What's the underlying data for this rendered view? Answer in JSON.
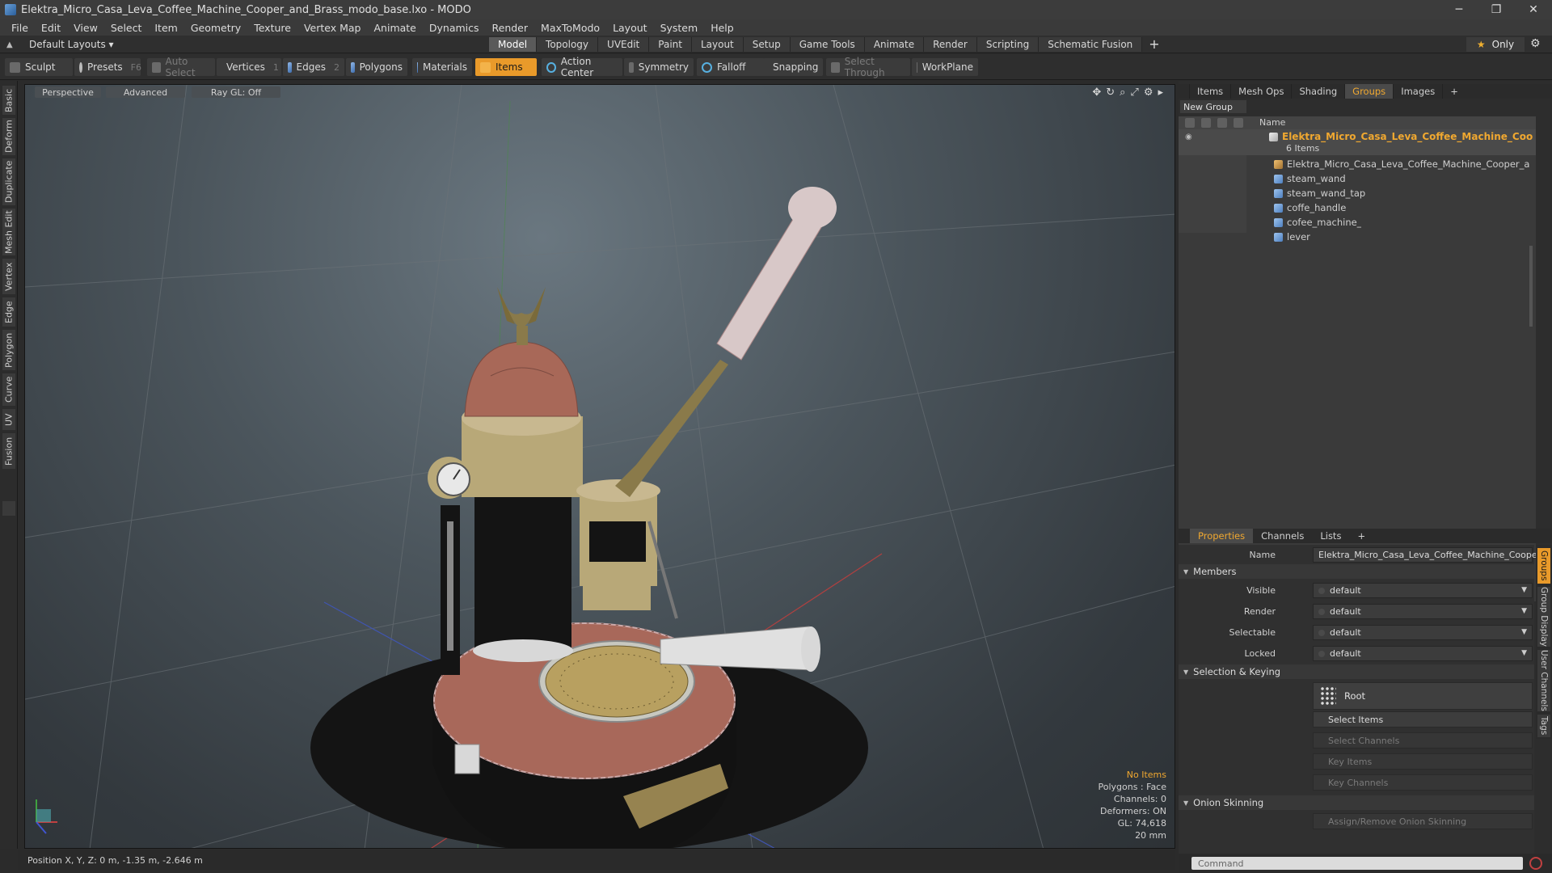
{
  "window": {
    "title": "Elektra_Micro_Casa_Leva_Coffee_Machine_Cooper_and_Brass_modo_base.lxo - MODO",
    "min": "─",
    "max": "❐",
    "close": "✕"
  },
  "menu": [
    "File",
    "Edit",
    "View",
    "Select",
    "Item",
    "Geometry",
    "Texture",
    "Vertex Map",
    "Animate",
    "Dynamics",
    "Render",
    "MaxToModo",
    "Layout",
    "System",
    "Help"
  ],
  "layout_selector": "Default Layouts ▾",
  "tabs": [
    "Model",
    "Topology",
    "UVEdit",
    "Paint",
    "Layout",
    "Setup",
    "Game Tools",
    "Animate",
    "Render",
    "Scripting",
    "Schematic Fusion"
  ],
  "active_tab": "Model",
  "tab_add": "+",
  "only_label": "Only",
  "toolbar": {
    "sculpt": "Sculpt",
    "presets": "Presets",
    "presets_key": "F6",
    "auto_select": "Auto Select",
    "vertices": "Vertices",
    "vertices_key": "1",
    "edges": "Edges",
    "edges_key": "2",
    "polygons": "Polygons",
    "materials": "Materials",
    "items": "Items",
    "action_center": "Action Center",
    "symmetry": "Symmetry",
    "falloff": "Falloff",
    "snapping": "Snapping",
    "select_through": "Select Through",
    "workplane": "WorkPlane"
  },
  "left_vtabs": [
    "Basic",
    "Deform",
    "Duplicate",
    "Mesh Edit",
    "Vertex",
    "Edge",
    "Polygon",
    "Curve",
    "UV",
    "Fusion"
  ],
  "viewport": {
    "view": "Perspective",
    "shading": "Advanced",
    "raygl": "Ray GL: Off",
    "info": {
      "no_items": "No Items",
      "polygons": "Polygons : Face",
      "channels": "Channels: 0",
      "deformers": "Deformers: ON",
      "gl": "GL: 74,618",
      "scale": "20 mm"
    }
  },
  "status": {
    "position": "Position X, Y, Z:  0 m, -1.35 m, -2.646 m"
  },
  "right_tabs": [
    "Items",
    "Mesh Ops",
    "Shading",
    "Groups",
    "Images"
  ],
  "right_active": "Groups",
  "right_add": "+",
  "new_group": "New Group",
  "tree": {
    "column_name": "Name",
    "group_name": "Elektra_Micro_Casa_Leva_Coffee_Machine_Cooper_ ...",
    "group_count": "6 Items",
    "items": [
      "Elektra_Micro_Casa_Leva_Coffee_Machine_Cooper_and_Br ...",
      "steam_wand",
      "steam_wand_tap",
      "coffe_handle",
      "cofee_machine_",
      "lever"
    ]
  },
  "prop_tabs": [
    "Properties",
    "Channels",
    "Lists"
  ],
  "prop_active": "Properties",
  "props": {
    "name_label": "Name",
    "name_value": "Elektra_Micro_Casa_Leva_Coffee_Machine_Cooper_",
    "members": "Members",
    "visible_label": "Visible",
    "visible_value": "default",
    "render_label": "Render",
    "render_value": "default",
    "selectable_label": "Selectable",
    "selectable_value": "default",
    "locked_label": "Locked",
    "locked_value": "default",
    "sel_keying": "Selection & Keying",
    "root": "Root",
    "select_items": "Select Items",
    "select_channels": "Select Channels",
    "key_items": "Key Items",
    "key_channels": "Key Channels",
    "onion": "Onion Skinning",
    "assign_onion": "Assign/Remove Onion Skinning"
  },
  "side_vtabs": [
    "Groups",
    "Group Display",
    "User Channels",
    "Tags"
  ],
  "command_placeholder": "Command"
}
